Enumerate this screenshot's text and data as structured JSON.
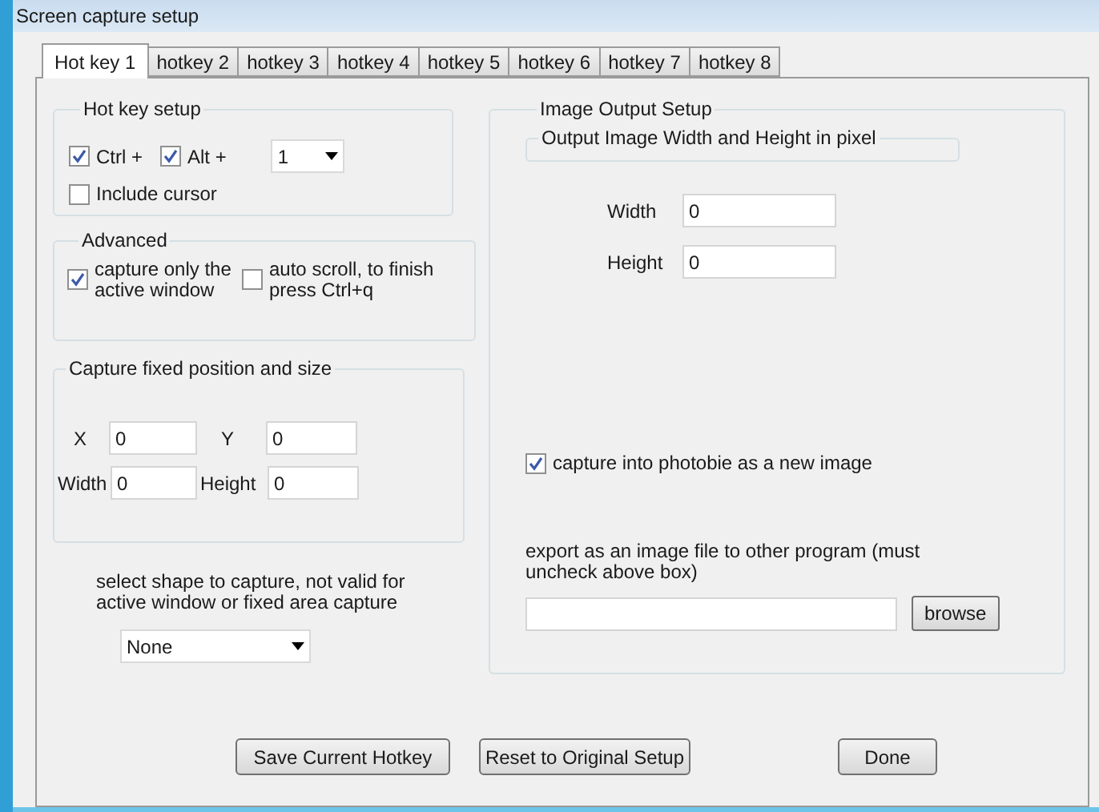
{
  "window": {
    "title": "Screen capture setup"
  },
  "tabs": [
    {
      "label": "Hot key 1",
      "selected": true
    },
    {
      "label": "hotkey 2",
      "selected": false
    },
    {
      "label": "hotkey 3",
      "selected": false
    },
    {
      "label": "hotkey 4",
      "selected": false
    },
    {
      "label": "hotkey 5",
      "selected": false
    },
    {
      "label": "hotkey 6",
      "selected": false
    },
    {
      "label": "hotkey 7",
      "selected": false
    },
    {
      "label": "hotkey 8",
      "selected": false
    }
  ],
  "hotkey_setup": {
    "title": "Hot key setup",
    "ctrl": {
      "label": "Ctrl +",
      "checked": true
    },
    "alt": {
      "label": "Alt +",
      "checked": true
    },
    "key_select": {
      "value": "1"
    },
    "include_cursor": {
      "label": "Include cursor",
      "checked": false
    }
  },
  "advanced": {
    "title": "Advanced",
    "options": [
      {
        "label": "capture only the active window",
        "checked": true
      },
      {
        "label": "auto scroll, to finish press Ctrl+q",
        "checked": false
      }
    ]
  },
  "fixed_area": {
    "title": "Capture fixed position and size",
    "fields": [
      {
        "label": "X",
        "value": "0"
      },
      {
        "label": "Y",
        "value": "0"
      },
      {
        "label": "Width",
        "value": "0"
      },
      {
        "label": "Height",
        "value": "0"
      }
    ]
  },
  "shape": {
    "note": "select shape to capture, not valid for active window or fixed area capture",
    "select": {
      "value": "None"
    }
  },
  "image_output": {
    "title": "Image Output Setup",
    "size_group": {
      "title": "Output Image Width and Height in pixel"
    },
    "fields": [
      {
        "label": "Width",
        "value": "0"
      },
      {
        "label": "Height",
        "value": "0"
      }
    ],
    "capture_into": {
      "label": "capture into photobie as a new image",
      "checked": true
    },
    "export_note": "export as an image file to other program (must uncheck above box)",
    "browse": "browse"
  },
  "buttons": [
    "Save Current Hotkey",
    "Reset to Original Setup",
    "Done"
  ]
}
